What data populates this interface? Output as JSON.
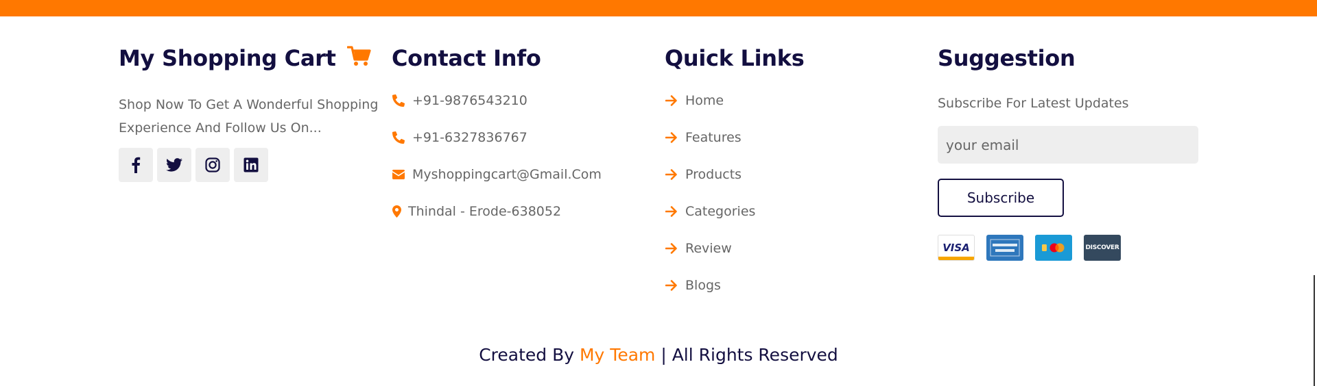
{
  "colors": {
    "accent": "#ff7800",
    "heading": "#130f40",
    "text": "#666666",
    "social_bg": "#eeeeee"
  },
  "brand": {
    "title": "My Shopping Cart",
    "icon": "shopping-cart-icon",
    "description": "Shop Now To Get A Wonderful Shopping Experience And Follow Us On..."
  },
  "social": [
    {
      "name": "facebook",
      "icon": "facebook-icon"
    },
    {
      "name": "twitter",
      "icon": "twitter-icon"
    },
    {
      "name": "instagram",
      "icon": "instagram-icon"
    },
    {
      "name": "linkedin",
      "icon": "linkedin-icon"
    }
  ],
  "contact": {
    "title": "Contact Info",
    "items": [
      {
        "icon": "phone-icon",
        "text": "+91-9876543210"
      },
      {
        "icon": "phone-icon",
        "text": "+91-6327836767"
      },
      {
        "icon": "envelope-icon",
        "text": "Myshoppingcart@Gmail.Com"
      },
      {
        "icon": "map-marker-icon",
        "text": "Thindal - Erode-638052"
      }
    ]
  },
  "quick_links": {
    "title": "Quick Links",
    "items": [
      {
        "icon": "arrow-right-icon",
        "text": "Home"
      },
      {
        "icon": "arrow-right-icon",
        "text": "Features"
      },
      {
        "icon": "arrow-right-icon",
        "text": "Products"
      },
      {
        "icon": "arrow-right-icon",
        "text": "Categories"
      },
      {
        "icon": "arrow-right-icon",
        "text": "Review"
      },
      {
        "icon": "arrow-right-icon",
        "text": "Blogs"
      }
    ]
  },
  "suggestion": {
    "title": "Suggestion",
    "subtitle": "Subscribe For Latest Updates",
    "email_placeholder": "your email",
    "subscribe_label": "Subscribe",
    "cards": [
      {
        "name": "visa",
        "label": "VISA",
        "icon": "visa-card-icon"
      },
      {
        "name": "amex",
        "label": "AMERICAN EXPRESS",
        "icon": "amex-card-icon"
      },
      {
        "name": "mastercard",
        "icon": "mastercard-icon"
      },
      {
        "name": "discover",
        "label": "DISCOVER",
        "icon": "discover-card-icon"
      }
    ]
  },
  "credit": {
    "prefix": "Created By ",
    "team": "My Team",
    "suffix": " | All Rights Reserved"
  }
}
